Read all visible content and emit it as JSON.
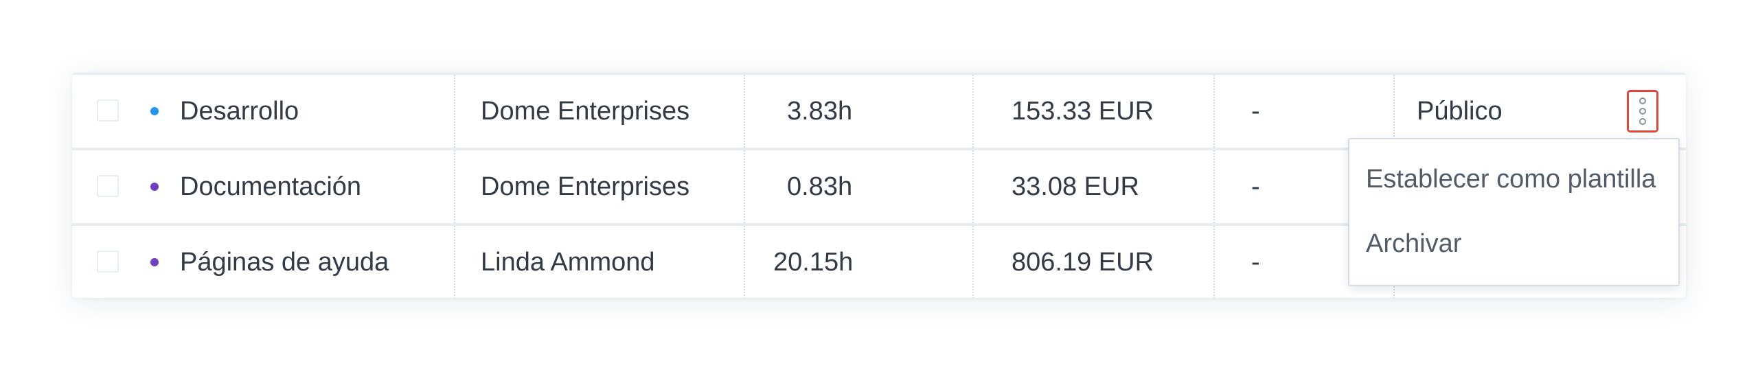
{
  "table": {
    "rows": [
      {
        "name": "Desarrollo",
        "dot_color": "#2196f3",
        "client": "Dome Enterprises",
        "hours": "3.83h",
        "amount": "153.33 EUR",
        "extra": "-",
        "visibility": "Público"
      },
      {
        "name": "Documentación",
        "dot_color": "#6c3fc4",
        "client": "Dome Enterprises",
        "hours": "0.83h",
        "amount": "33.08 EUR",
        "extra": "-",
        "visibility": ""
      },
      {
        "name": "Páginas de ayuda",
        "dot_color": "#6c3fc4",
        "client": "Linda Ammond",
        "hours": "20.15h",
        "amount": "806.19 EUR",
        "extra": "-",
        "visibility": ""
      }
    ]
  },
  "menu": {
    "items": [
      {
        "label": "Establecer como plantilla"
      },
      {
        "label": "Archivar"
      }
    ]
  },
  "colors": {
    "accent_border": "#e0473a"
  },
  "icons": {
    "more": "more-vertical-icon"
  }
}
